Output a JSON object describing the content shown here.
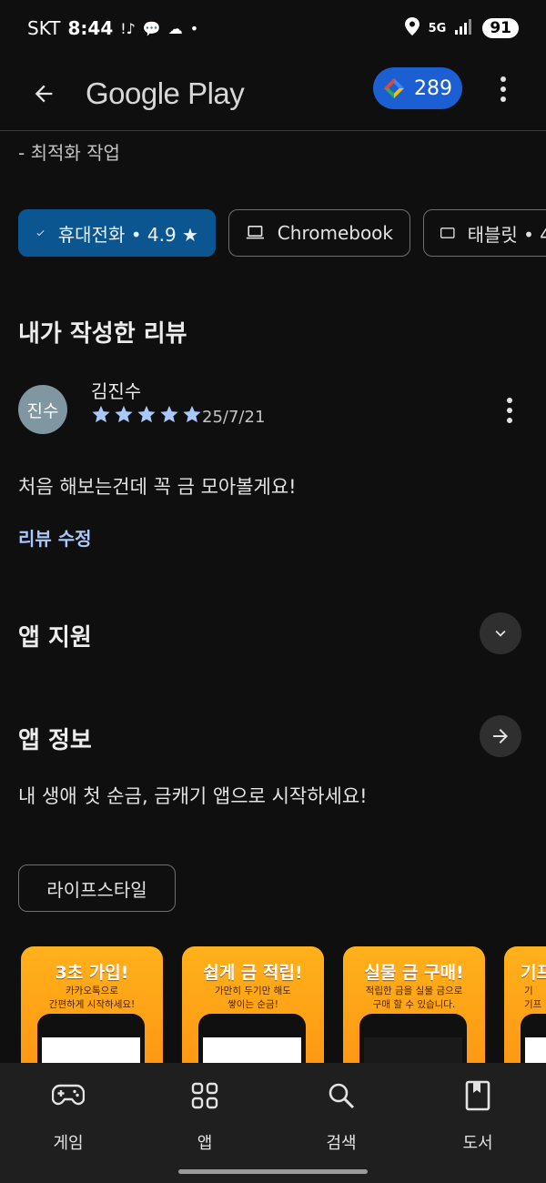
{
  "status_bar": {
    "carrier": "SKT",
    "time": "8:44",
    "network": "5G",
    "battery": "91"
  },
  "app_bar": {
    "title": "Google Play",
    "points": "289"
  },
  "feature_line": "- 최적화 작업",
  "device_chips": [
    {
      "label": "휴대전화 • 4.9 ★",
      "selected": true,
      "icon": "check-icon"
    },
    {
      "label": "Chromebook",
      "selected": false,
      "icon": "laptop-icon"
    },
    {
      "label": "태블릿 • 4",
      "selected": false,
      "icon": "tablet-icon"
    }
  ],
  "my_review": {
    "heading": "내가 작성한 리뷰",
    "avatar_text": "진수",
    "reviewer": "김진수",
    "rating": 5,
    "date": "25/7/21",
    "text": "처음 해보는건데 꼭 금 모아볼게요!",
    "edit_label": "리뷰 수정"
  },
  "app_support": {
    "heading": "앱 지원",
    "icon": "chevron-down-icon"
  },
  "app_info": {
    "heading": "앱 정보",
    "icon": "arrow-right-icon",
    "description": "내 생애 첫 순금, 금캐기 앱으로 시작하세요!",
    "category": "라이프스타일"
  },
  "screenshots": [
    {
      "title": "3초 가입!",
      "sub1": "카카오톡으로",
      "sub2": "간편하게 시작하세요!"
    },
    {
      "title": "쉽게 금 적립!",
      "sub1": "가만히 두기만 해도",
      "sub2": "쌓이는 순금!"
    },
    {
      "title": "실물 금 구매!",
      "sub1": "적립한 금을 실물 금으로",
      "sub2": "구매 할 수 있습니다."
    },
    {
      "title": "기프",
      "sub1": "기",
      "sub2": "기프"
    }
  ],
  "bottom_nav": [
    {
      "label": "게임",
      "icon": "gamepad-icon"
    },
    {
      "label": "앱",
      "icon": "apps-grid-icon"
    },
    {
      "label": "검색",
      "icon": "search-icon"
    },
    {
      "label": "도서",
      "icon": "book-icon"
    }
  ],
  "colors": {
    "background": "#0f0f0f",
    "accent_chip": "#0b5690",
    "points_pill": "#1c5fd2",
    "link": "#a8c7fa",
    "star": "#a8c7fa"
  }
}
